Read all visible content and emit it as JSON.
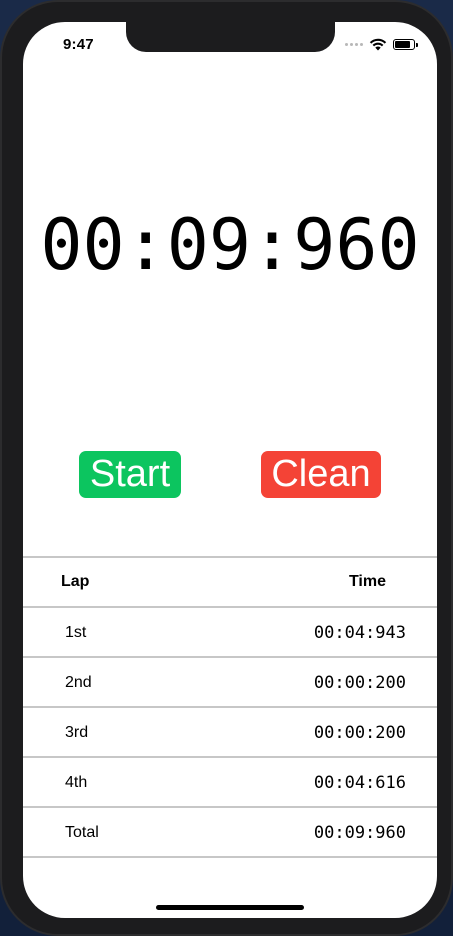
{
  "status_bar": {
    "time": "9:47",
    "icons": [
      "signal-icon",
      "wifi-icon",
      "battery-icon"
    ]
  },
  "timer": {
    "display": "00:09:960"
  },
  "buttons": {
    "start_label": "Start",
    "clean_label": "Clean",
    "start_color": "#0cc55f",
    "clean_color": "#f44336"
  },
  "lap_table": {
    "headers": {
      "lap": "Lap",
      "time": "Time"
    },
    "rows": [
      {
        "lap": "1st",
        "time": "00:04:943"
      },
      {
        "lap": "2nd",
        "time": "00:00:200"
      },
      {
        "lap": "3rd",
        "time": "00:00:200"
      },
      {
        "lap": "4th",
        "time": "00:04:616"
      },
      {
        "lap": "Total",
        "time": "00:09:960"
      }
    ]
  }
}
